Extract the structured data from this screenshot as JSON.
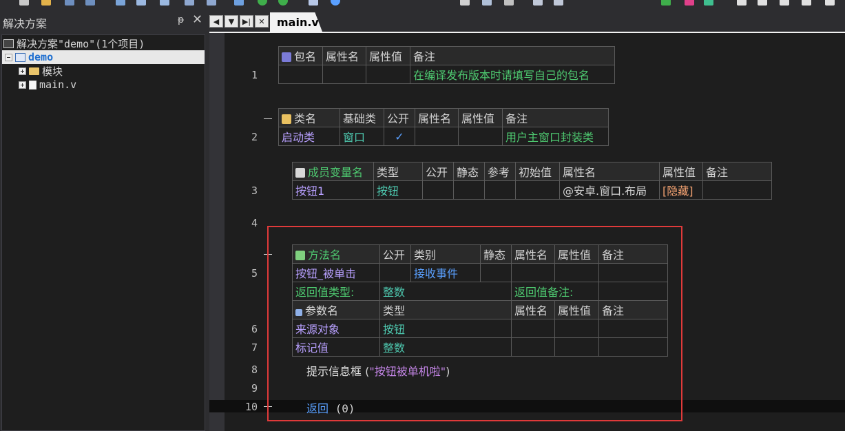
{
  "panel": {
    "title": "解决方案",
    "pin_glyph": "ᵽ",
    "close_glyph": "✕",
    "tree": [
      {
        "label": "解决方案\"demo\"(1个项目)",
        "kind": "solution"
      },
      {
        "label": "demo",
        "kind": "project",
        "selected": true
      },
      {
        "label": "模块",
        "kind": "folder"
      },
      {
        "label": "main.v",
        "kind": "file"
      }
    ]
  },
  "tabs": {
    "nav": [
      "◀",
      "▼",
      "▶|",
      "✕"
    ],
    "active": "main.v"
  },
  "editor": {
    "line_numbers": [
      "1",
      "2",
      "3",
      "4",
      "5",
      "6",
      "7",
      "8",
      "9",
      "10"
    ],
    "package_table": {
      "headers": [
        "包名",
        "属性名",
        "属性值",
        "备注"
      ],
      "row": [
        "",
        "",
        "",
        "在编译发布版本时请填写自己的包名"
      ]
    },
    "class_table": {
      "headers": [
        "类名",
        "基础类",
        "公开",
        "属性名",
        "属性值",
        "备注"
      ],
      "row": [
        "启动类",
        "窗口",
        "✓",
        "",
        "",
        "用户主窗口封装类"
      ]
    },
    "member_table": {
      "headers": [
        "成员变量名",
        "类型",
        "公开",
        "静态",
        "参考",
        "初始值",
        "属性名",
        "属性值",
        "备注"
      ],
      "row": [
        "按钮1",
        "按钮",
        "",
        "",
        "",
        "",
        "@安卓.窗口.布局",
        "[隐藏]",
        ""
      ]
    },
    "method_table": {
      "headers": [
        "方法名",
        "公开",
        "类别",
        "静态",
        "属性名",
        "属性值",
        "备注"
      ],
      "row": [
        "按钮_被单击",
        "",
        "接收事件",
        "",
        "",
        "",
        ""
      ],
      "return_type_label": "返回值类型:",
      "return_type": "整数",
      "return_note_label": "返回值备注:",
      "param_headers": [
        "参数名",
        "类型",
        "属性名",
        "属性值",
        "备注"
      ],
      "params": [
        {
          "name": "来源对象",
          "type": "按钮"
        },
        {
          "name": "标记值",
          "type": "整数"
        }
      ]
    },
    "code": {
      "line8_func": "提示信息框",
      "line8_open": " (",
      "line8_string": "\"按钮被单机啦\"",
      "line8_close": ")",
      "line10_keyword": "返回",
      "line10_args": " (0)"
    }
  }
}
